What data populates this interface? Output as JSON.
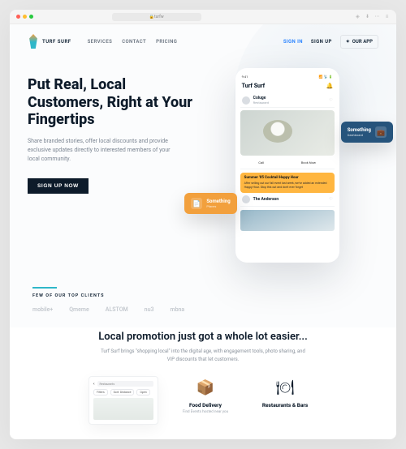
{
  "browser": {
    "url": "turfw",
    "toolbar_icons": [
      "shield-icon",
      "download-icon",
      "extension-icon",
      "menu-icon"
    ]
  },
  "brand": {
    "name": "TURF SURF",
    "accent": "#2fb7c9"
  },
  "nav": [
    "SERVICES",
    "CONTACT",
    "PRICING"
  ],
  "auth": {
    "sign_in": "SIGN IN",
    "sign_up": "SIGN UP",
    "our_app": "OUR APP"
  },
  "hero": {
    "title": "Put Real, Local Customers, Right at Your Fingertips",
    "subtitle": "Share branded stories, offer local discounts and provide exclusive updates directly to interested members of your local community.",
    "cta": "SIGN UP NOW"
  },
  "phone": {
    "status_time": "9:41",
    "status_icons": "📶 📡 🔋",
    "title": "Turf Surf",
    "items": [
      {
        "name": "Coluge",
        "sub": "Restaurant"
      }
    ],
    "tabs": [
      "Call",
      "Book Now"
    ],
    "promo_title": "Summer '05 Cocktail Happy Hour",
    "promo_body": "After selling out our fall event last week, we've added an extended Happy Hour. Stop this out and don't ever forget",
    "secondary_name": "The Anderson"
  },
  "float_cards": {
    "blue": {
      "label": "Something",
      "sub": "Dashboard"
    },
    "orange": {
      "label": "Something",
      "sub": "Places"
    }
  },
  "clients": {
    "label": "FEW OF OUR TOP CLIENTS",
    "list": [
      "mobile+",
      "Qmeme",
      "ALSTOM",
      "nu3",
      "mbna"
    ]
  },
  "section2": {
    "title": "Local promotion just got a whole lot easier...",
    "subtitle": "Turf Surf brings \"shopping local\" into the digital age, with engagement tools, photo sharing, and VIP discounts that let customers.",
    "map": {
      "search_label": "Restaurants",
      "filter_label": "Filters",
      "chip1": "Sort: Distance",
      "chip2": "Open"
    },
    "features": [
      {
        "icon": "📦",
        "title": "Food Delivery",
        "desc": "Find Events hosted near you"
      },
      {
        "icon": "🍽",
        "title": "Restaurants & Bars",
        "desc": ""
      }
    ]
  }
}
